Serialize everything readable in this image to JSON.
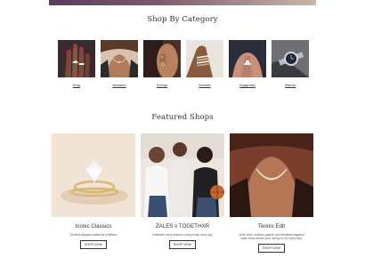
{
  "categories": {
    "title": "Shop By Category",
    "items": [
      {
        "label": "Rings"
      },
      {
        "label": "Necklaces"
      },
      {
        "label": "Earrings"
      },
      {
        "label": "Bracelets"
      },
      {
        "label": "Engagement"
      },
      {
        "label": "Watches"
      }
    ]
  },
  "featured": {
    "title": "Featured Shops",
    "shops": [
      {
        "name": "Iconic Classics",
        "desc": "Timeless designs crafted for a lifetime.",
        "button": "SHOP NOW"
      },
      {
        "name": "ZALES x TOGETHXR",
        "desc": "Celebrate every moment, every body, every day.",
        "button": "SHOP NOW"
      },
      {
        "name": "Tennis Edit",
        "desc": "Clean lines, endless sparkle, and effortless elegance make these pieces your new go-to for every look.",
        "button": "SHOP NOW"
      }
    ]
  },
  "colors": {
    "banner": "#5a3d5c",
    "text": "#333333",
    "button_border": "#333333"
  }
}
